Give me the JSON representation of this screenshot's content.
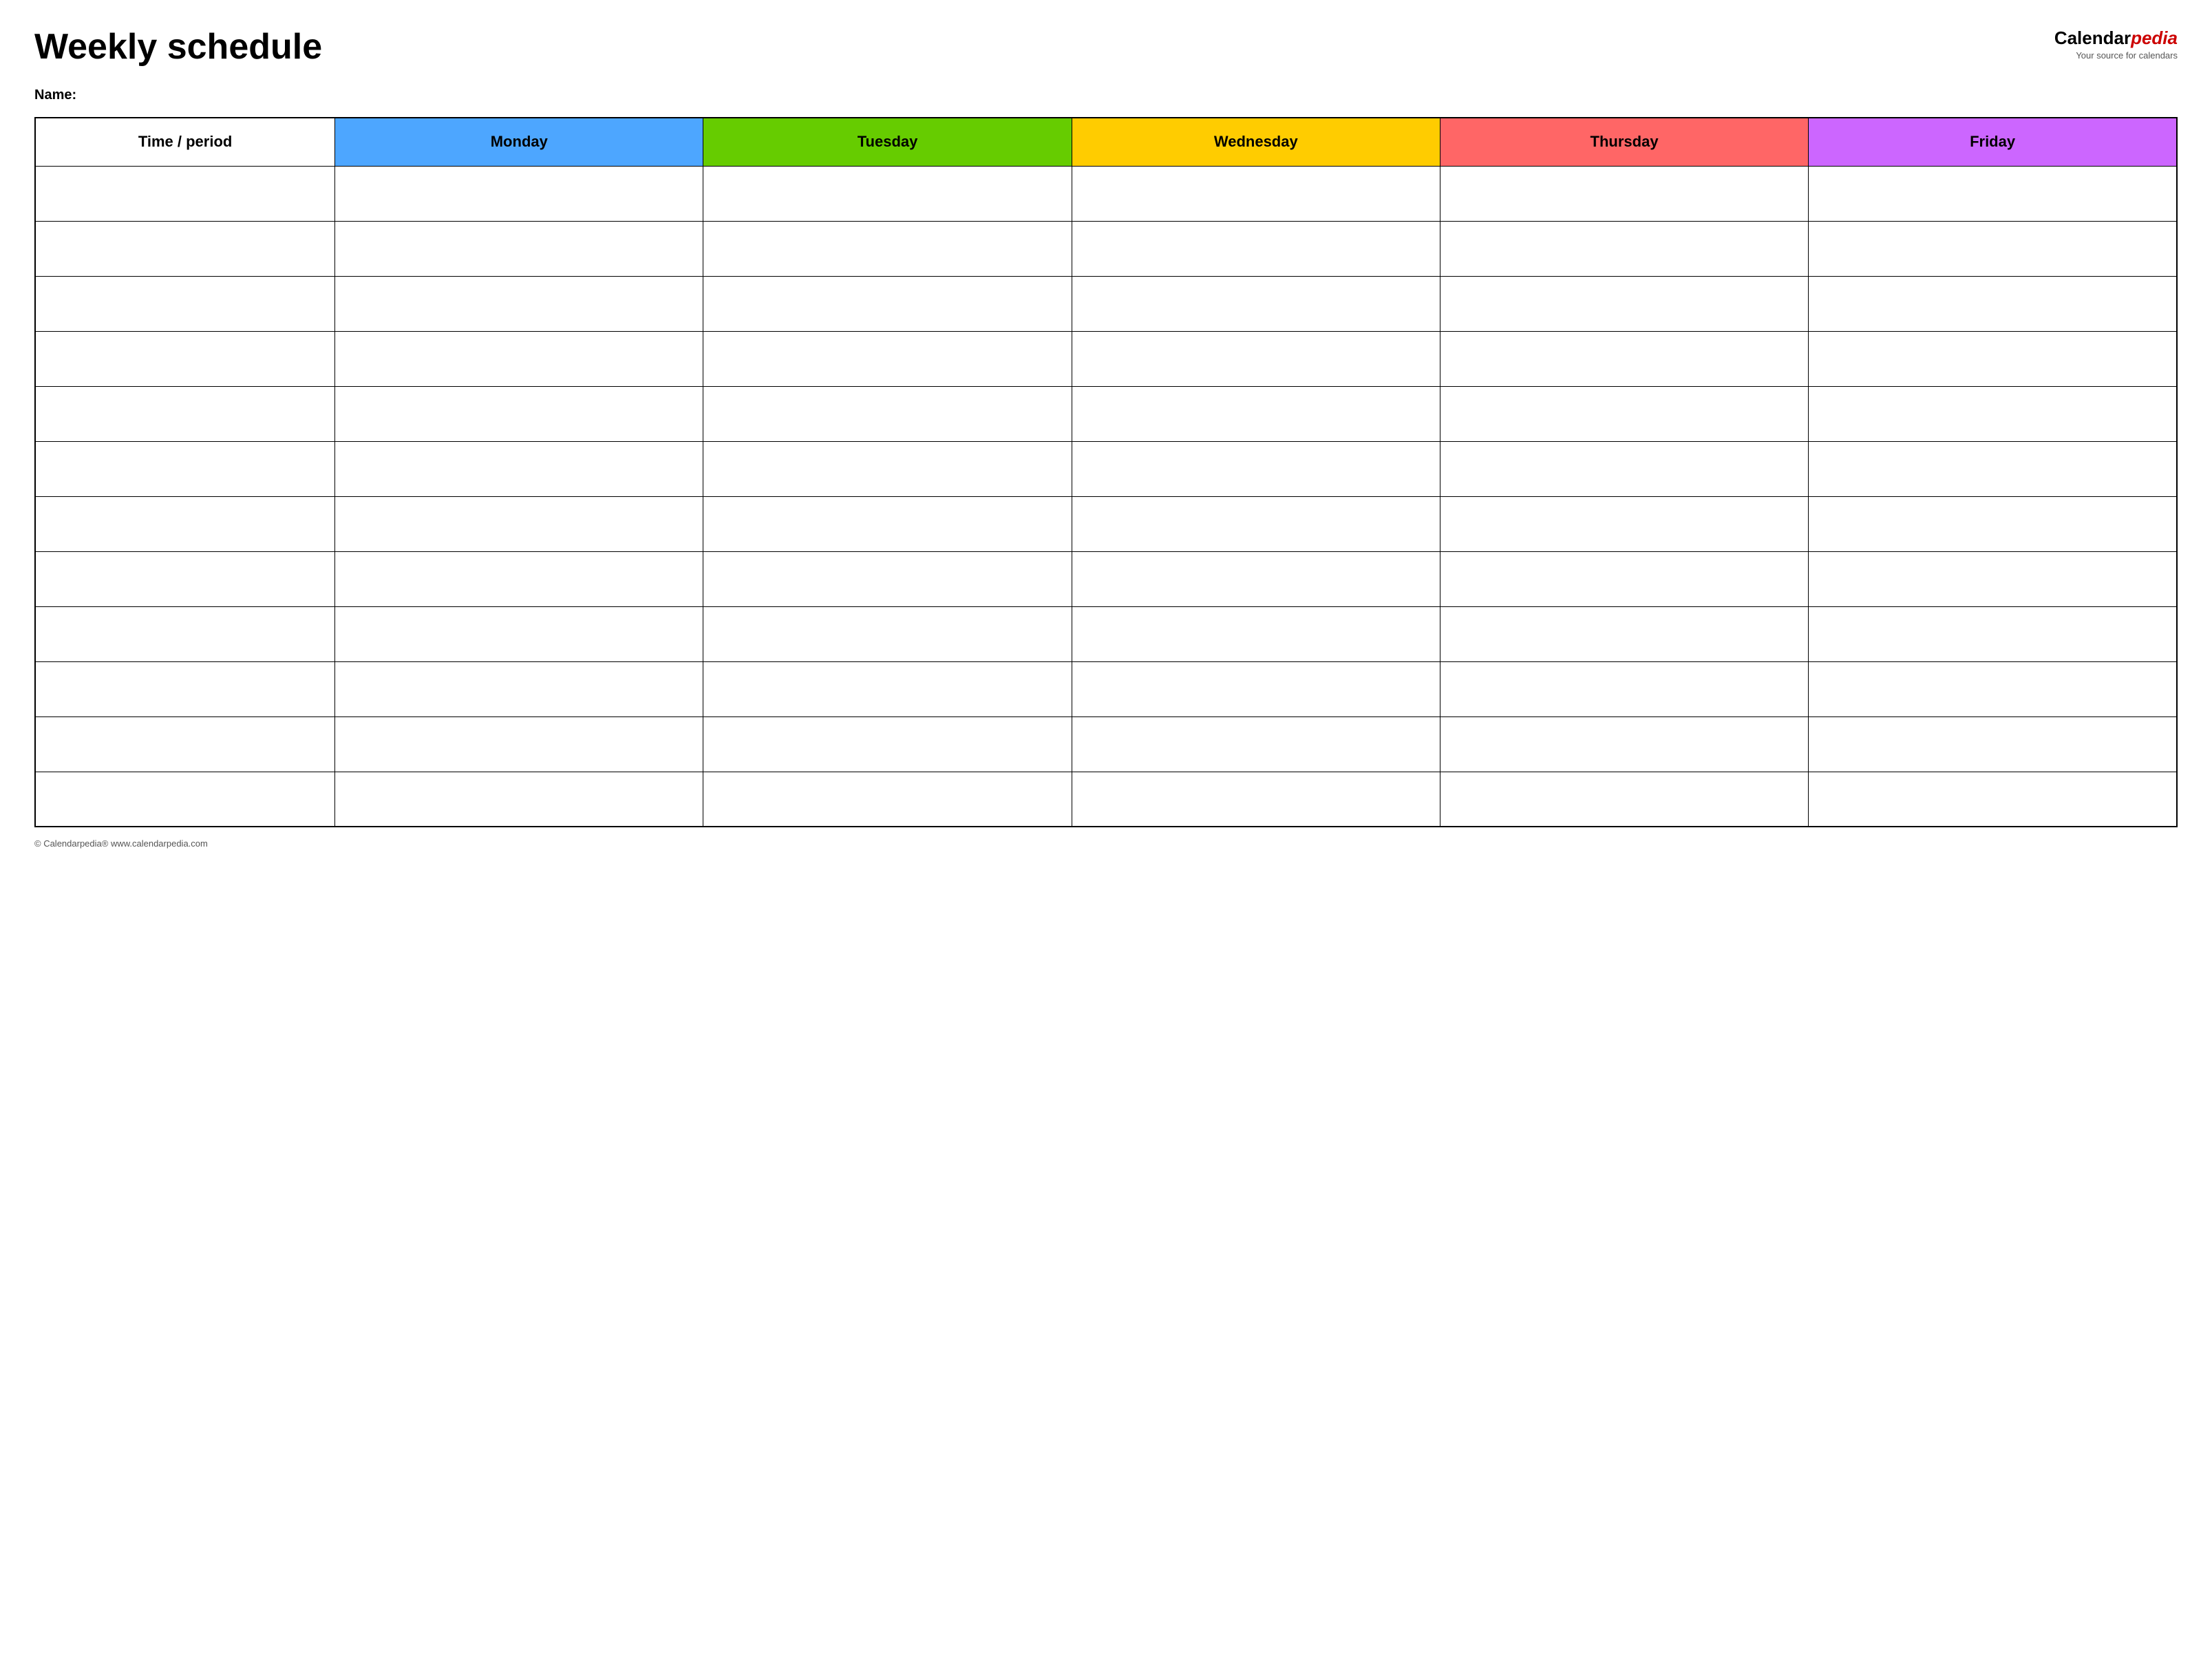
{
  "header": {
    "title": "Weekly schedule",
    "logo": {
      "calendar_part": "Calendar",
      "pedia_part": "pedia",
      "tagline": "Your source for calendars"
    }
  },
  "name_label": "Name:",
  "table": {
    "columns": [
      {
        "id": "time",
        "label": "Time / period",
        "color": "#ffffff"
      },
      {
        "id": "monday",
        "label": "Monday",
        "color": "#4da6ff"
      },
      {
        "id": "tuesday",
        "label": "Tuesday",
        "color": "#66cc00"
      },
      {
        "id": "wednesday",
        "label": "Wednesday",
        "color": "#ffcc00"
      },
      {
        "id": "thursday",
        "label": "Thursday",
        "color": "#ff6666"
      },
      {
        "id": "friday",
        "label": "Friday",
        "color": "#cc66ff"
      }
    ],
    "row_count": 12
  },
  "footer": {
    "text": "© Calendarpedia®  www.calendarpedia.com"
  }
}
